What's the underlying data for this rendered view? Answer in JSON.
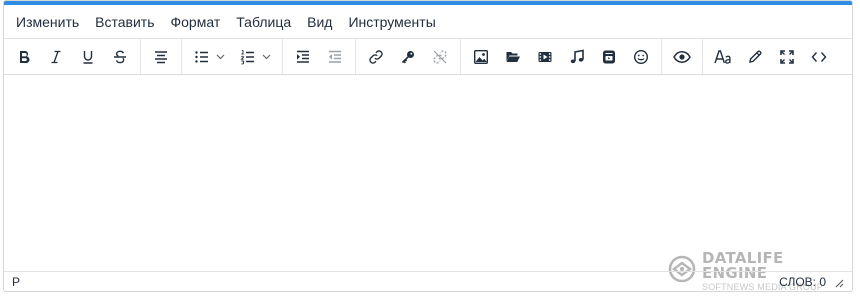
{
  "menubar": {
    "items": [
      "Изменить",
      "Вставить",
      "Формат",
      "Таблица",
      "Вид",
      "Инструменты"
    ]
  },
  "toolbar": {
    "icons": [
      "bold-icon",
      "italic-icon",
      "underline-icon",
      "strikethrough-icon",
      "align-center-icon",
      "bullet-list-icon",
      "numbered-list-icon",
      "indent-icon",
      "outdent-icon",
      "link-icon",
      "key-icon",
      "unlink-icon",
      "image-icon",
      "folder-open-icon",
      "video-icon",
      "music-icon",
      "media-embed-icon",
      "emoticon-icon",
      "preview-eye-icon",
      "font-size-icon",
      "pen-icon",
      "fullscreen-icon",
      "code-icon"
    ]
  },
  "statusbar": {
    "path": "P",
    "word_count": "СЛОВ: 0"
  },
  "watermark": {
    "title": "DATALIFE ENGINE",
    "subtitle": "SOFTNEWS MEDIA GROUP"
  },
  "colors": {
    "accent": "#2f8de4",
    "icon": "#222f3e",
    "disabled": "#9aa0a6"
  }
}
